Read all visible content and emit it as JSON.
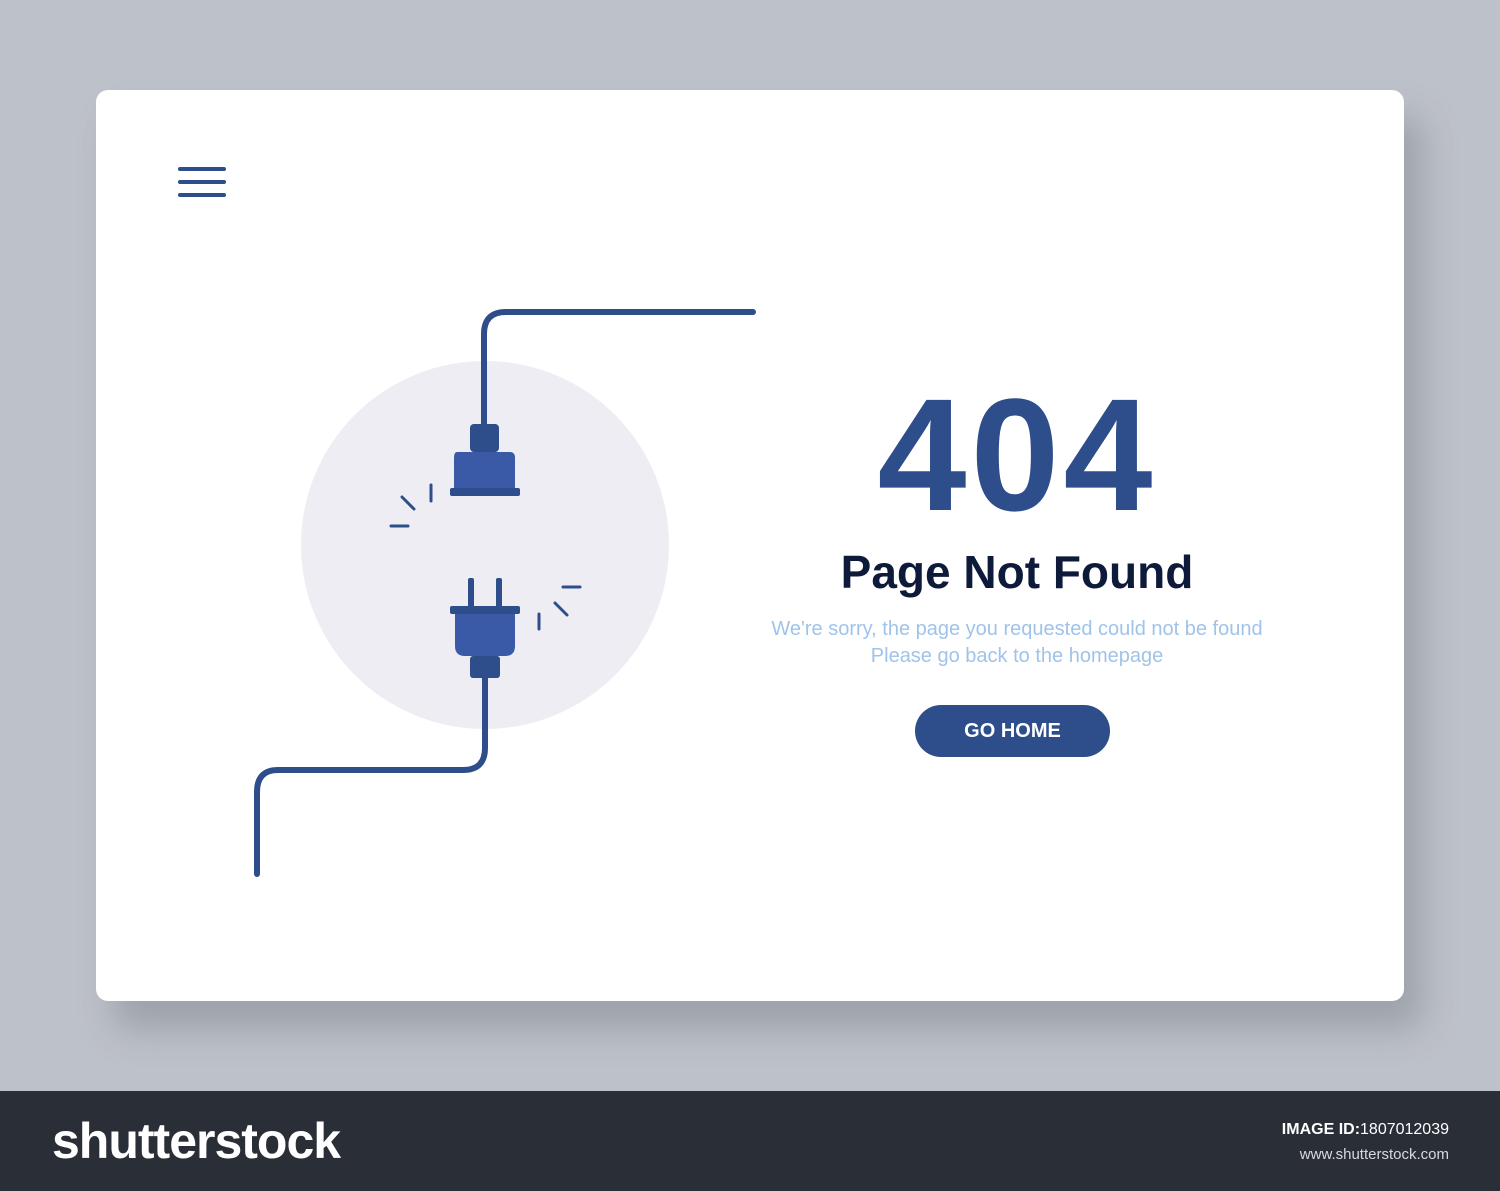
{
  "page": {
    "error_code": "404",
    "title": "Page Not Found",
    "message_line1": "We're sorry, the page you requested could not be found",
    "message_line2": "Please go back to the homepage",
    "button_label": "GO HOME"
  },
  "header": {
    "menu_icon": "hamburger-menu-icon"
  },
  "illustration": {
    "icon": "unplugged-plug-icon"
  },
  "footer": {
    "logo": "shutterstock",
    "image_id_label": "IMAGE ID:",
    "image_id": "1807012039",
    "url": "www.shutterstock.com"
  },
  "colors": {
    "accent": "#2d4e8a",
    "plug": "#3a5aa8",
    "circle": "#ededf3",
    "message": "#9fc3ea",
    "title": "#0e1a3a",
    "background": "#bdc1c9",
    "footer": "#2a2e36"
  }
}
